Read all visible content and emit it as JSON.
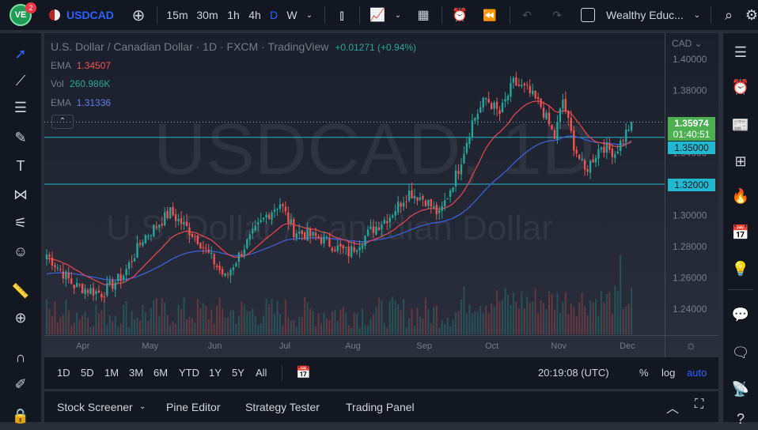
{
  "topbar": {
    "badge": "2",
    "symbol": "USDCAD",
    "intervals": [
      "15m",
      "30m",
      "1h",
      "4h",
      "D",
      "W"
    ],
    "active_interval": "D",
    "layout_name": "Wealthy Educ..."
  },
  "legend": {
    "title": "U.S. Dollar / Canadian Dollar · 1D · FXCM · TradingView",
    "change": "+0.01271 (+0.94%)",
    "ema1_label": "EMA",
    "ema1_value": "1.34507",
    "vol_label": "Vol",
    "vol_value": "260.986K",
    "ema2_label": "EMA",
    "ema2_value": "1.31336"
  },
  "watermark": {
    "line1": "USDCAD, 1D",
    "line2": "U.S. Dollar / Canadian Dollar"
  },
  "price_axis": {
    "currency": "CAD",
    "current_price": "1.35974",
    "countdown": "01:40:51",
    "line1": "1.35000",
    "line2": "1.32000"
  },
  "bottombar": {
    "ranges": [
      "1D",
      "5D",
      "1M",
      "3M",
      "6M",
      "YTD",
      "1Y",
      "5Y",
      "All"
    ],
    "time": "20:19:08 (UTC)",
    "percent": "%",
    "log": "log",
    "auto": "auto"
  },
  "panel": {
    "tabs": [
      "Stock Screener",
      "Pine Editor",
      "Strategy Tester",
      "Trading Panel"
    ]
  },
  "colors": {
    "up": "#26a69a",
    "down": "#ef5350",
    "ema_fast": "#e0434f",
    "ema_slow": "#3a5fd6",
    "hline": "#22b8cf",
    "accent": "#2962ff"
  },
  "chart_data": {
    "type": "candlestick",
    "ylim": [
      1.23,
      1.41
    ],
    "y_ticks": [
      "1.40000",
      "1.38000",
      "1.36000",
      "1.34000",
      "1.32000",
      "1.30000",
      "1.28000",
      "1.26000",
      "1.24000"
    ],
    "y_tick_values": [
      1.4,
      1.38,
      1.36,
      1.34,
      1.32,
      1.3,
      1.28,
      1.26,
      1.24
    ],
    "x_ticks": [
      "Apr",
      "May",
      "Jun",
      "Jul",
      "Aug",
      "Sep",
      "Oct",
      "Nov",
      "Dec"
    ],
    "x_tick_days": [
      13,
      37,
      61,
      87,
      111,
      137,
      162,
      186,
      211
    ],
    "horizontal_lines": [
      1.35,
      1.32
    ],
    "last_price": 1.35974,
    "close_anchors": [
      [
        0,
        1.275
      ],
      [
        10,
        1.255
      ],
      [
        20,
        1.25
      ],
      [
        28,
        1.262
      ],
      [
        35,
        1.285
      ],
      [
        45,
        1.302
      ],
      [
        55,
        1.285
      ],
      [
        65,
        1.26
      ],
      [
        72,
        1.28
      ],
      [
        80,
        1.3
      ],
      [
        85,
        1.308
      ],
      [
        90,
        1.29
      ],
      [
        100,
        1.285
      ],
      [
        105,
        1.28
      ],
      [
        110,
        1.276
      ],
      [
        118,
        1.29
      ],
      [
        125,
        1.3
      ],
      [
        132,
        1.315
      ],
      [
        138,
        1.31
      ],
      [
        143,
        1.3
      ],
      [
        150,
        1.33
      ],
      [
        155,
        1.36
      ],
      [
        160,
        1.375
      ],
      [
        165,
        1.365
      ],
      [
        170,
        1.385
      ],
      [
        175,
        1.38
      ],
      [
        180,
        1.37
      ],
      [
        185,
        1.35
      ],
      [
        188,
        1.374
      ],
      [
        192,
        1.345
      ],
      [
        196,
        1.328
      ],
      [
        202,
        1.345
      ],
      [
        207,
        1.34
      ],
      [
        213,
        1.3597
      ]
    ]
  }
}
